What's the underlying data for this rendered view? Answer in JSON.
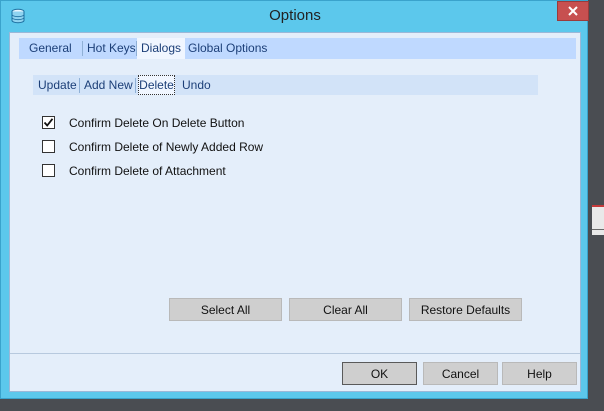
{
  "window": {
    "title": "Options",
    "accent_color": "#5cc8ec",
    "close_icon": "close-icon",
    "app_icon": "database-icon"
  },
  "main_tabs": [
    {
      "label": "General"
    },
    {
      "label": "Hot Keys"
    },
    {
      "label": "Dialogs",
      "active": true
    },
    {
      "label": "Global Options"
    }
  ],
  "sub_tabs": [
    {
      "label": "Update"
    },
    {
      "label": "Add New"
    },
    {
      "label": "Delete",
      "active": true
    },
    {
      "label": "Undo"
    }
  ],
  "options": [
    {
      "label": "Confirm Delete On Delete Button",
      "checked": true
    },
    {
      "label": "Confirm Delete of Newly Added Row",
      "checked": false
    },
    {
      "label": "Confirm Delete of Attachment",
      "checked": false
    }
  ],
  "actions": {
    "select_all": "Select All",
    "clear_all": "Clear All",
    "restore_defaults": "Restore Defaults"
  },
  "footer": {
    "ok": "OK",
    "cancel": "Cancel",
    "help": "Help"
  }
}
